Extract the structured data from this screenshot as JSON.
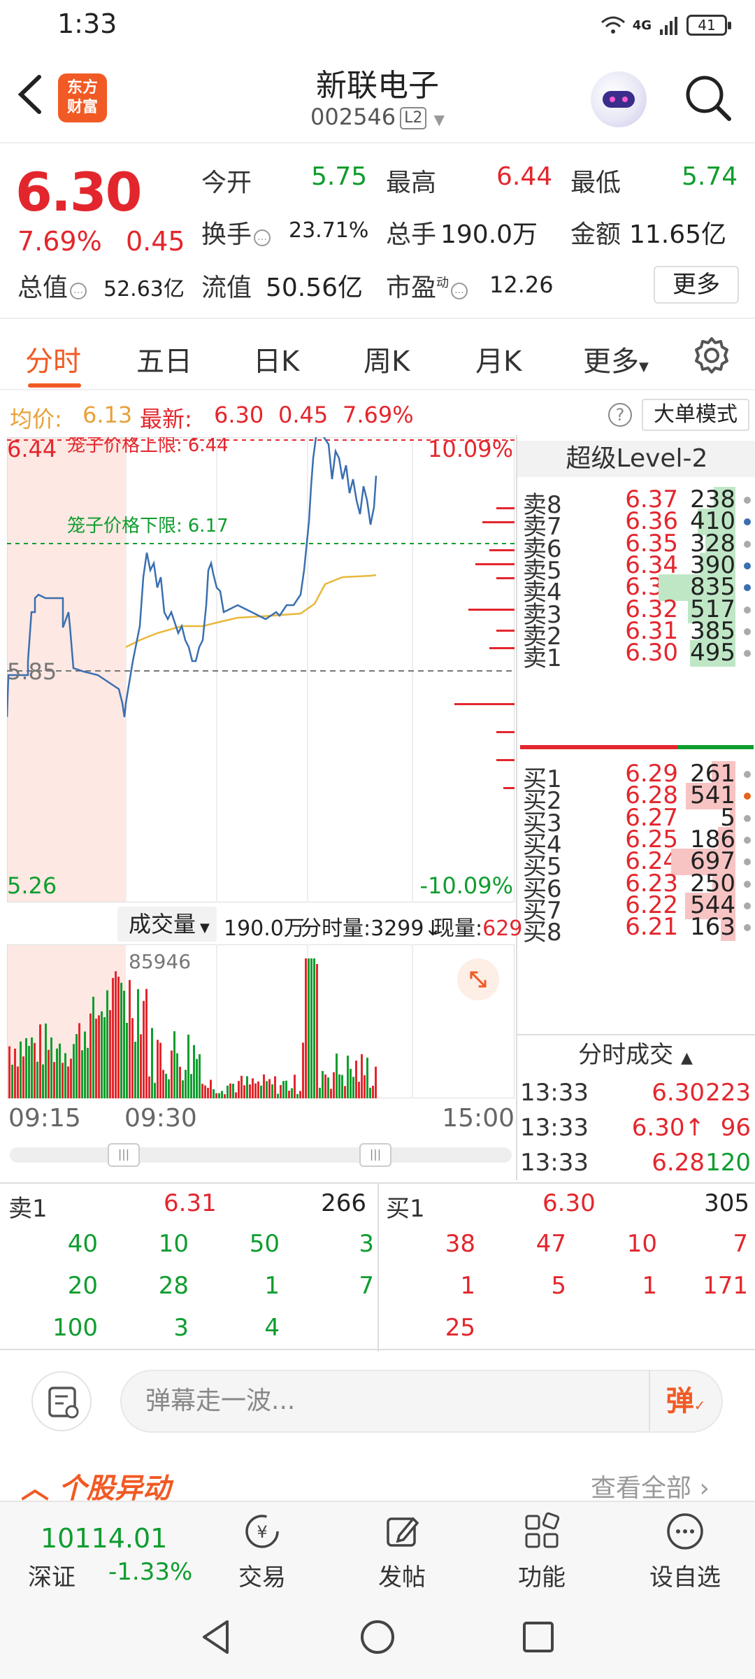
{
  "status": {
    "time": "1:33",
    "network": "4G",
    "battery": "41"
  },
  "header": {
    "name": "新联电子",
    "code": "002546",
    "level": "L2",
    "logo_line1": "东方",
    "logo_line2": "财富"
  },
  "quote": {
    "price": "6.30",
    "pct": "7.69%",
    "change": "0.45",
    "open_label": "今开",
    "open": "5.75",
    "high_label": "最高",
    "high": "6.44",
    "low_label": "最低",
    "low": "5.74",
    "turnover_label": "换手",
    "turnover": "23.71%",
    "volume_label": "总手",
    "volume": "190.0万",
    "amount_label": "金额",
    "amount": "11.65亿",
    "mktcap_label": "总值",
    "mktcap": "52.63亿",
    "float_label": "流值",
    "float": "50.56亿",
    "pe_label": "市盈",
    "pe_sup": "动",
    "pe": "12.26",
    "more": "更多"
  },
  "tabs": [
    "分时",
    "五日",
    "日K",
    "周K",
    "月K",
    "更多"
  ],
  "avg_row": {
    "avg_label": "均价:",
    "avg": "6.13",
    "last_label": "最新:",
    "last": "6.30",
    "chg": "0.45",
    "pct": "7.69%",
    "help": "?",
    "big_order": "大单模式"
  },
  "chart": {
    "top_price": "6.44",
    "upper_limit_label": "笼子价格上限:",
    "upper_limit": "6.44",
    "lower_limit_label": "笼子价格下限:",
    "lower_limit": "6.17",
    "prev_close": "5.85",
    "bottom_price": "5.26",
    "top_pct": "10.09%",
    "bottom_pct": "-10.09%",
    "vol_label": "成交量",
    "vol_total": "190.0万",
    "vol_min_label": "分时量:",
    "vol_min": "3299",
    "cur_label": "现量:",
    "cur": "629",
    "vol_max": "85946",
    "times": [
      "09:15",
      "09:30",
      "15:00"
    ]
  },
  "chart_data": {
    "type": "line",
    "title": "",
    "y_range": [
      5.26,
      6.44
    ],
    "prev_close": 5.85,
    "x": [
      "09:15",
      "09:30",
      "15:00"
    ],
    "series": [],
    "volume_max": 85946
  },
  "level2": {
    "title": "超级Level-2",
    "asks": [
      {
        "label": "卖8",
        "price": "6.37",
        "vol": "238"
      },
      {
        "label": "卖7",
        "price": "6.36",
        "vol": "410"
      },
      {
        "label": "卖6",
        "price": "6.35",
        "vol": "328"
      },
      {
        "label": "卖5",
        "price": "6.34",
        "vol": "390"
      },
      {
        "label": "卖4",
        "price": "6.33",
        "vol": "835"
      },
      {
        "label": "卖3",
        "price": "6.32",
        "vol": "517"
      },
      {
        "label": "卖2",
        "price": "6.31",
        "vol": "385"
      },
      {
        "label": "卖1",
        "price": "6.30",
        "vol": "495"
      }
    ],
    "bids": [
      {
        "label": "买1",
        "price": "6.29",
        "vol": "261"
      },
      {
        "label": "买2",
        "price": "6.28",
        "vol": "541"
      },
      {
        "label": "买3",
        "price": "6.27",
        "vol": "5"
      },
      {
        "label": "买4",
        "price": "6.25",
        "vol": "186"
      },
      {
        "label": "买5",
        "price": "6.24",
        "vol": "697"
      },
      {
        "label": "买6",
        "price": "6.23",
        "vol": "250"
      },
      {
        "label": "买7",
        "price": "6.22",
        "vol": "544"
      },
      {
        "label": "买8",
        "price": "6.21",
        "vol": "163"
      }
    ]
  },
  "trades": {
    "title": "分时成交",
    "rows": [
      {
        "time": "13:33",
        "price": "6.30",
        "vol": "223"
      },
      {
        "time": "13:33",
        "price": "6.30↑",
        "vol": "96"
      },
      {
        "time": "13:33",
        "price": "6.28",
        "vol": "120"
      }
    ]
  },
  "queue": {
    "sell_label": "卖1",
    "sell_price": "6.31",
    "sell_total": "266",
    "buy_label": "买1",
    "buy_price": "6.30",
    "buy_total": "305",
    "sell_orders": [
      "40",
      "10",
      "50",
      "3",
      "20",
      "28",
      "1",
      "7",
      "100",
      "3",
      "4"
    ],
    "buy_orders": [
      "38",
      "47",
      "10",
      "7",
      "1",
      "5",
      "1",
      "171",
      "25"
    ]
  },
  "comment": {
    "placeholder": "弹幕走一波...",
    "danmu": "弹"
  },
  "unusual": {
    "title": "个股异动",
    "view_all": "查看全部"
  },
  "bottom": {
    "index_value": "10114.01",
    "index_name": "深证",
    "index_pct": "-1.33%",
    "nav": [
      "交易",
      "发帖",
      "功能",
      "设自选"
    ]
  },
  "colors": {
    "up": "#e3262d",
    "down": "#0f9d2f",
    "brand": "#f15a24",
    "price_line": "#3a6fb0",
    "avg_line": "#e8b83a"
  }
}
